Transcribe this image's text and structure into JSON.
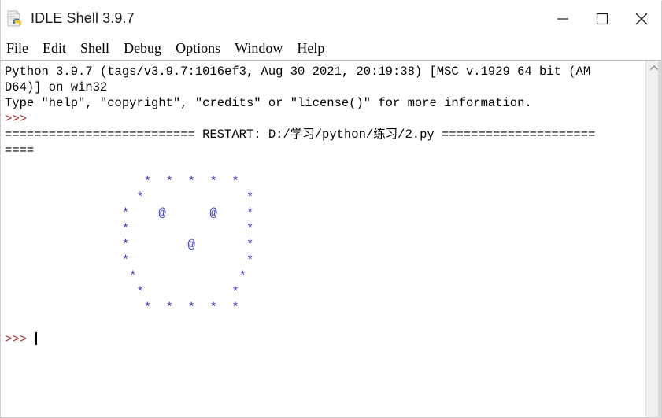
{
  "window": {
    "title": "IDLE Shell 3.9.7",
    "icon": "python-idle-icon",
    "controls": {
      "minimize": "Minimize",
      "maximize": "Maximize",
      "close": "Close"
    }
  },
  "menubar": {
    "items": [
      {
        "label": "File",
        "mnemonic": "F",
        "before": "",
        "after": "ile"
      },
      {
        "label": "Edit",
        "mnemonic": "E",
        "before": "",
        "after": "dit"
      },
      {
        "label": "Shell",
        "mnemonic": "l",
        "before": "She",
        "after": ""
      },
      {
        "label": "Debug",
        "mnemonic": "D",
        "before": "",
        "after": "ebug"
      },
      {
        "label": "Options",
        "mnemonic": "O",
        "before": "",
        "after": "ptions"
      },
      {
        "label": "Window",
        "mnemonic": "W",
        "before": "",
        "after": "indow"
      },
      {
        "label": "Help",
        "mnemonic": "H",
        "before": "",
        "after": "elp"
      }
    ]
  },
  "shell": {
    "colors": {
      "prompt": "#a83232",
      "output": "#3333cc",
      "text": "#000000",
      "background": "#ffffff"
    },
    "lines": [
      {
        "kind": "text",
        "text": "Python 3.9.7 (tags/v3.9.7:1016ef3, Aug 30 2021, 20:19:38) [MSC v.1929 64 bit (AM"
      },
      {
        "kind": "text",
        "text": "D64)] on win32"
      },
      {
        "kind": "text",
        "text": "Type \"help\", \"copyright\", \"credits\" or \"license()\" for more information."
      },
      {
        "kind": "prompt",
        "text": ">>> "
      },
      {
        "kind": "text",
        "text": "========================== RESTART: D:/学习/python/练习/2.py ====================="
      },
      {
        "kind": "text",
        "text": "===="
      },
      {
        "kind": "blank",
        "text": ""
      },
      {
        "kind": "out",
        "text": "                   *  *  *  *  *"
      },
      {
        "kind": "out",
        "text": "                  *              *"
      },
      {
        "kind": "out",
        "text": "                *    @      @    *"
      },
      {
        "kind": "out",
        "text": "                *                *"
      },
      {
        "kind": "out",
        "text": "                *        @       *"
      },
      {
        "kind": "out",
        "text": "                *                *"
      },
      {
        "kind": "out",
        "text": "                 *              *"
      },
      {
        "kind": "out",
        "text": "                  *            *"
      },
      {
        "kind": "out",
        "text": "                   *  *  *  *  *"
      },
      {
        "kind": "blank",
        "text": ""
      },
      {
        "kind": "prompt_caret",
        "text": ">>> "
      }
    ]
  },
  "scrollbar": {
    "up_arrow": "chevron-up-icon",
    "down_arrow": "chevron-down-icon",
    "position": "top"
  }
}
